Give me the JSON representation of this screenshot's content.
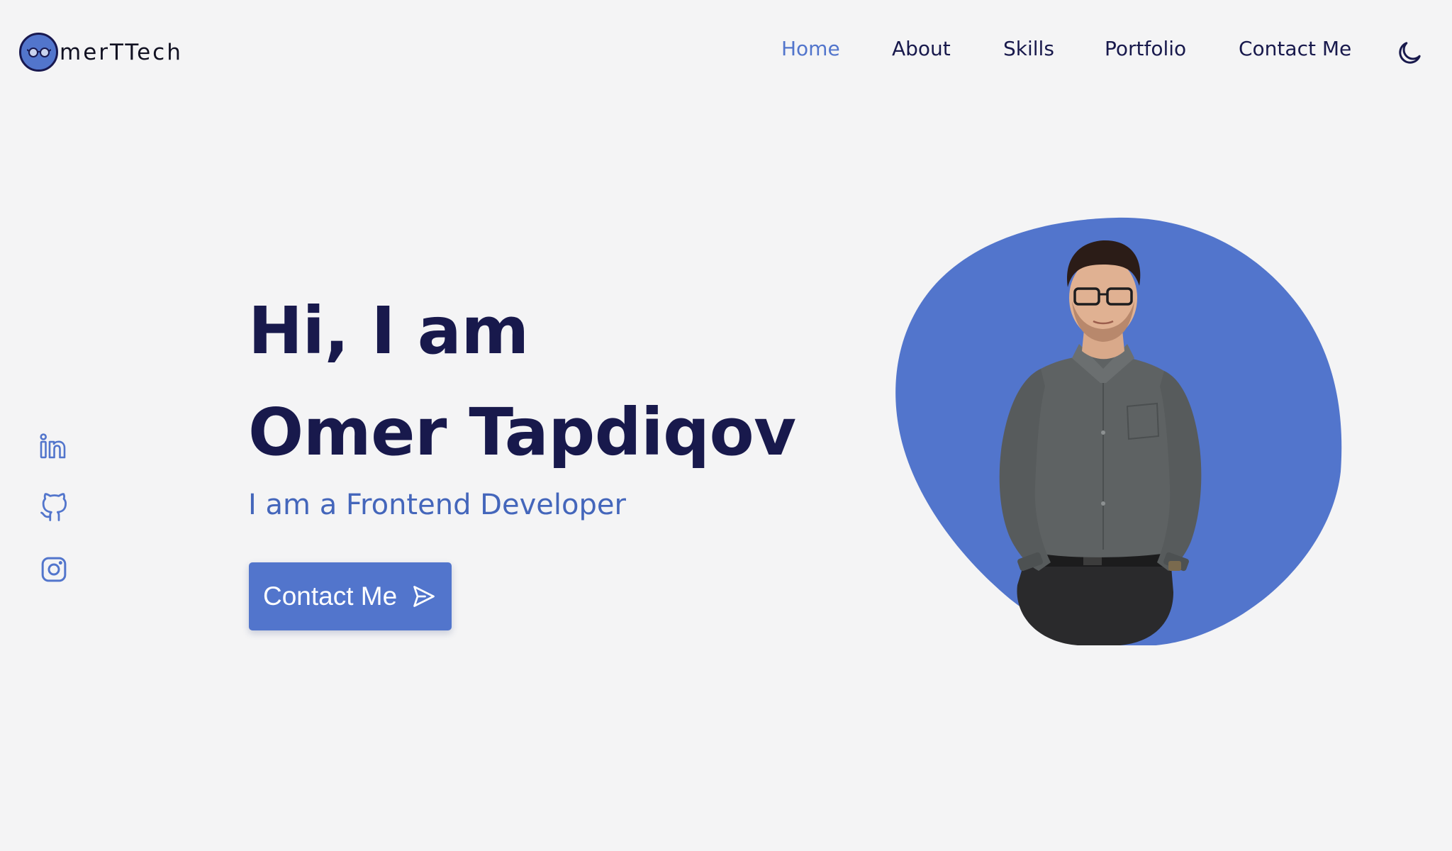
{
  "brand": {
    "logo_text": "merTTech",
    "logo_icon": "glasses-avatar-icon"
  },
  "nav": {
    "items": [
      {
        "label": "Home",
        "active": true
      },
      {
        "label": "About",
        "active": false
      },
      {
        "label": "Skills",
        "active": false
      },
      {
        "label": "Portfolio",
        "active": false
      },
      {
        "label": "Contact Me",
        "active": false
      }
    ],
    "theme_toggle_icon": "moon-icon"
  },
  "social": [
    {
      "icon": "linkedin-icon"
    },
    {
      "icon": "github-icon"
    },
    {
      "icon": "instagram-icon"
    }
  ],
  "hero": {
    "greeting": "Hi, I am",
    "name": "Omer Tapdiqov",
    "subtitle": "I am a Frontend Developer",
    "cta_label": "Contact Me",
    "cta_icon": "send-icon"
  },
  "colors": {
    "background": "#f4f4f5",
    "primary": "#5275cc",
    "heading": "#18194c",
    "accent_text": "#4466bb"
  }
}
